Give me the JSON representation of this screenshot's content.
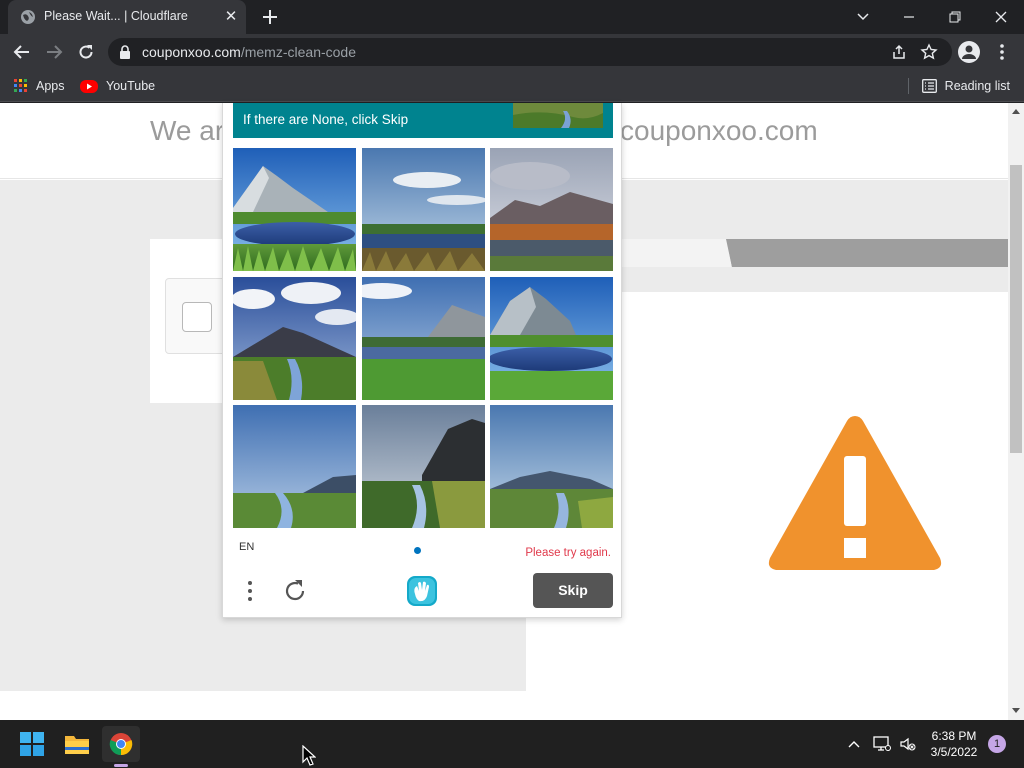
{
  "browser": {
    "tab": {
      "title": "Please Wait... | Cloudflare",
      "close_glyph": "✕"
    },
    "address": {
      "domain": "couponxoo.com",
      "path": "/memz-clean-code"
    },
    "bookmarks": [
      {
        "label": "Apps",
        "icon": "apps-grid-icon"
      },
      {
        "label": "YouTube",
        "icon": "youtube-icon"
      }
    ],
    "reading_list": "Reading list"
  },
  "page": {
    "title_left": "We ar",
    "title_right": "couponxoo.com",
    "warning_color": "#f0922d"
  },
  "captcha": {
    "prompt": "If there are None, click Skip",
    "prompt_color": "#00838f",
    "images": [
      {
        "name": "mountain-lake-1"
      },
      {
        "name": "marsh-sky-2"
      },
      {
        "name": "mountain-pond-3"
      },
      {
        "name": "volcano-creek-4"
      },
      {
        "name": "mountain-field-5"
      },
      {
        "name": "mountain-lake-6"
      },
      {
        "name": "blue-sky-creek-7"
      },
      {
        "name": "cliff-creek-8"
      },
      {
        "name": "hill-creek-9"
      }
    ],
    "language": "EN",
    "error": "Please try again.",
    "skip_label": "Skip"
  },
  "taskbar": {
    "time": "6:38 PM",
    "date": "3/5/2022",
    "notification_count": "1"
  }
}
